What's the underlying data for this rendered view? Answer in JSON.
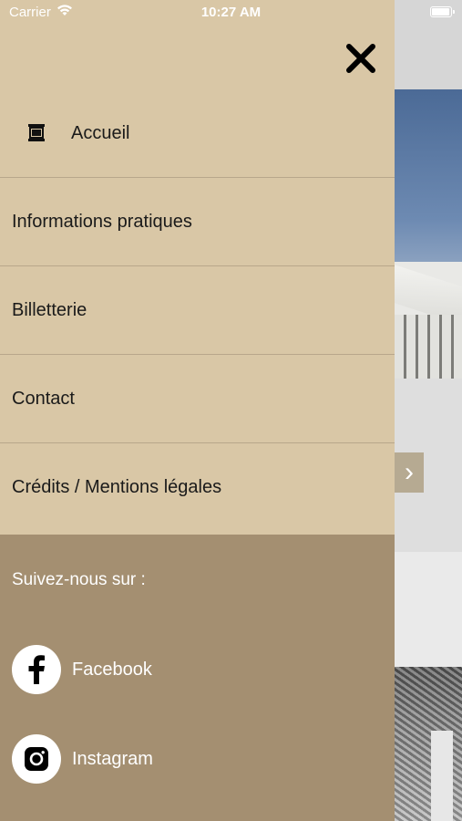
{
  "status_bar": {
    "carrier": "Carrier",
    "time": "10:27 AM"
  },
  "drawer": {
    "menu_items": [
      {
        "label": "Accueil",
        "icon": "home-icon"
      },
      {
        "label": "Informations pratiques"
      },
      {
        "label": "Billetterie"
      },
      {
        "label": "Contact"
      },
      {
        "label": "Crédits / Mentions légales"
      }
    ],
    "social": {
      "title": "Suivez-nous sur :",
      "links": [
        {
          "label": "Facebook",
          "icon": "facebook-icon"
        },
        {
          "label": "Instagram",
          "icon": "instagram-icon"
        }
      ]
    }
  },
  "colors": {
    "drawer_bg": "#d9c7a6",
    "social_bg": "#a48f71",
    "divider": "#b8a78b"
  }
}
